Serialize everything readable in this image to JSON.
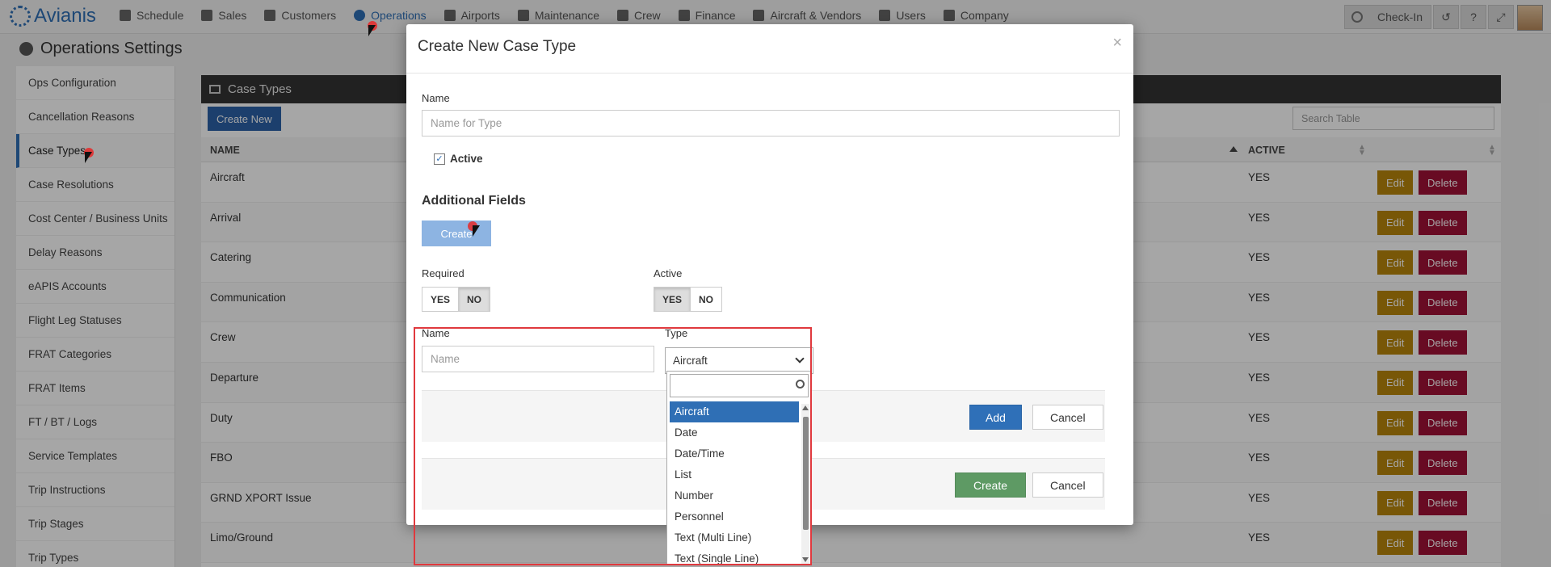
{
  "app": {
    "brand": "Avianis",
    "nav": [
      {
        "label": "Schedule",
        "icon": "calendar-icon"
      },
      {
        "label": "Sales",
        "icon": "document-icon"
      },
      {
        "label": "Customers",
        "icon": "users-icon"
      },
      {
        "label": "Operations",
        "icon": "globe-icon",
        "active": true
      },
      {
        "label": "Airports",
        "icon": "map-marker-icon"
      },
      {
        "label": "Maintenance",
        "icon": "wrench-icon"
      },
      {
        "label": "Crew",
        "icon": "id-card-icon"
      },
      {
        "label": "Finance",
        "icon": "dollar-icon"
      },
      {
        "label": "Aircraft & Vendors",
        "icon": "plane-icon"
      },
      {
        "label": "Users",
        "icon": "user-icon"
      },
      {
        "label": "Company",
        "icon": "bank-icon"
      }
    ],
    "checkin_label": "Check-In"
  },
  "page": {
    "title": "Operations Settings"
  },
  "sidebar": {
    "items": [
      {
        "label": "Ops Configuration"
      },
      {
        "label": "Cancellation Reasons"
      },
      {
        "label": "Case Types",
        "active": true
      },
      {
        "label": "Case Resolutions"
      },
      {
        "label": "Cost Center / Business Units"
      },
      {
        "label": "Delay Reasons"
      },
      {
        "label": "eAPIS Accounts"
      },
      {
        "label": "Flight Leg Statuses"
      },
      {
        "label": "FRAT Categories"
      },
      {
        "label": "FRAT Items"
      },
      {
        "label": "FT / BT / Logs"
      },
      {
        "label": "Service Templates"
      },
      {
        "label": "Trip Instructions"
      },
      {
        "label": "Trip Stages"
      },
      {
        "label": "Trip Types"
      }
    ]
  },
  "panel": {
    "title": "Case Types",
    "create_new_label": "Create New",
    "search_placeholder": "Search Table",
    "columns": {
      "name": "NAME",
      "active": "ACTIVE"
    },
    "rows": [
      {
        "name": "Aircraft",
        "active": "YES"
      },
      {
        "name": "Arrival",
        "active": "YES"
      },
      {
        "name": "Catering",
        "active": "YES"
      },
      {
        "name": "Communication",
        "active": "YES"
      },
      {
        "name": "Crew",
        "active": "YES"
      },
      {
        "name": "Departure",
        "active": "YES"
      },
      {
        "name": "Duty",
        "active": "YES"
      },
      {
        "name": "FBO",
        "active": "YES"
      },
      {
        "name": "GRND XPORT Issue",
        "active": "YES"
      },
      {
        "name": "Limo/Ground",
        "active": "YES"
      }
    ],
    "edit_label": "Edit",
    "delete_label": "Delete"
  },
  "modal": {
    "title": "Create New Case Type",
    "close_symbol": "×",
    "name_label": "Name",
    "name_placeholder": "Name for Type",
    "active_checkbox_label": "Active",
    "additional_fields_title": "Additional Fields",
    "create_field_label": "Create",
    "required_label": "Required",
    "active_label": "Active",
    "yes_label": "YES",
    "no_label": "NO",
    "field_name_label": "Name",
    "field_name_placeholder": "Name",
    "field_type_label": "Type",
    "field_type_value": "Aircraft",
    "add_label": "Add",
    "cancel_label": "Cancel",
    "create_label": "Create",
    "type_options": [
      "Aircraft",
      "Date",
      "Date/Time",
      "List",
      "Number",
      "Personnel",
      "Text (Multi Line)",
      "Text (Single Line)"
    ]
  }
}
